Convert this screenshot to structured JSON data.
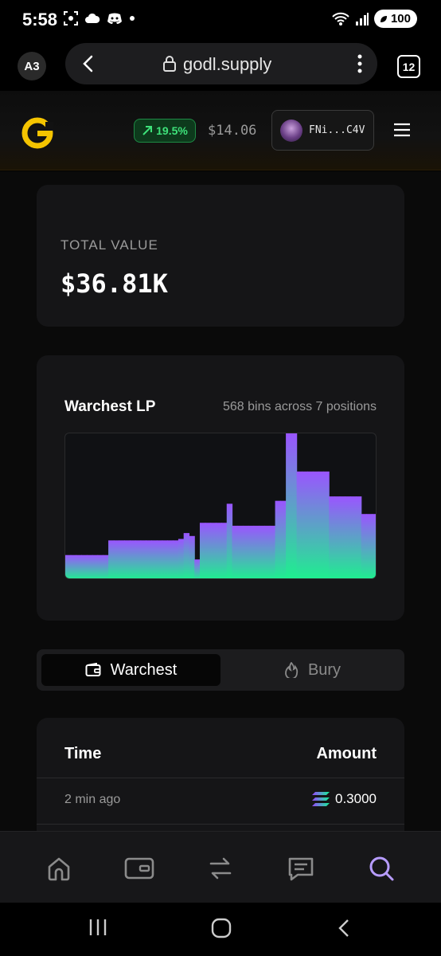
{
  "status_bar": {
    "time": "5:58",
    "battery": "100"
  },
  "browser": {
    "profile": "A3",
    "url": "godl.supply",
    "tab_count": "12"
  },
  "header": {
    "change_pct": "19.5%",
    "price": "$14.06",
    "wallet_address": "FNi...C4V",
    "change_color": "#3ee27a"
  },
  "total_value": {
    "label": "TOTAL VALUE",
    "value": "$36.81K"
  },
  "warchest_lp": {
    "title": "Warchest LP",
    "subtitle": "568 bins across 7 positions"
  },
  "chart_data": {
    "type": "area",
    "title": "Warchest LP",
    "xlabel": "",
    "ylabel": "",
    "grid": false,
    "values": [
      0.17,
      0.17,
      0.17,
      0.17,
      0.17,
      0.17,
      0.17,
      0.17,
      0.27,
      0.27,
      0.27,
      0.27,
      0.27,
      0.27,
      0.27,
      0.27,
      0.27,
      0.27,
      0.27,
      0.27,
      0.27,
      0.28,
      0.32,
      0.3,
      0.14,
      0.39,
      0.39,
      0.39,
      0.39,
      0.39,
      0.52,
      0.37,
      0.37,
      0.37,
      0.37,
      0.37,
      0.37,
      0.37,
      0.37,
      0.54,
      0.54,
      1.0,
      1.0,
      0.74,
      0.74,
      0.74,
      0.74,
      0.74,
      0.74,
      0.57,
      0.57,
      0.57,
      0.57,
      0.57,
      0.57,
      0.45,
      0.45,
      0.45
    ],
    "colors": {
      "top": "#9a55ff",
      "bottom": "#1df08e"
    }
  },
  "tabs": {
    "active": "Warchest",
    "inactive": "Bury"
  },
  "table": {
    "headers": [
      "Time",
      "Amount"
    ],
    "rows": [
      {
        "time": "2 min ago",
        "amount": "0.3000",
        "icon": "solana-icon"
      }
    ]
  },
  "bottom_nav": [
    {
      "icon": "home-icon",
      "active": false
    },
    {
      "icon": "wallet-icon",
      "active": false
    },
    {
      "icon": "swap-icon",
      "active": false
    },
    {
      "icon": "chat-icon",
      "active": false
    },
    {
      "icon": "search-icon",
      "active": true
    }
  ],
  "accent_color": "#b79cff"
}
